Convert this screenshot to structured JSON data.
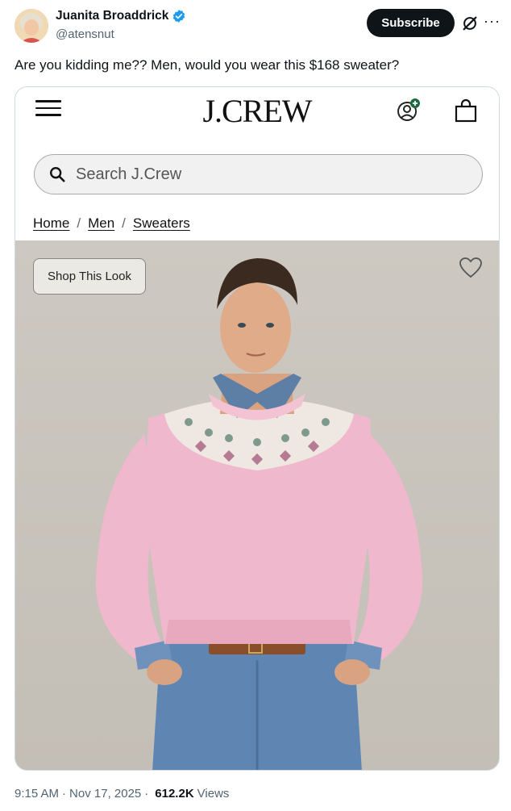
{
  "tweet": {
    "author_name": "Juanita Broaddrick",
    "handle": "@atensnut",
    "subscribe_label": "Subscribe",
    "text": "Are you kidding me??  Men, would you wear this $168 sweater?",
    "time": "9:15 AM",
    "date": "Nov 17, 2025",
    "views_count": "612.2K",
    "views_label": "Views",
    "separator": "·"
  },
  "embedded_screenshot": {
    "logo": "J.CREW",
    "search_placeholder": "Search J.Crew",
    "breadcrumb": [
      {
        "label": "Home"
      },
      {
        "label": "Men"
      },
      {
        "label": "Sweaters"
      }
    ],
    "breadcrumb_separator": "/",
    "shop_look_label": "Shop This Look"
  },
  "icons": {
    "verified": "verified-badge-icon",
    "grok": "grok-icon",
    "more": "more-icon",
    "menu": "menu-icon",
    "profile": "profile-icon",
    "bag": "shopping-bag-icon",
    "search": "search-icon",
    "heart": "heart-icon"
  },
  "colors": {
    "verified_blue": "#1d9bf0",
    "subscribe_bg": "#0f1419",
    "secondary_text": "#536471",
    "sweater_pink": "#f0b8cc"
  }
}
